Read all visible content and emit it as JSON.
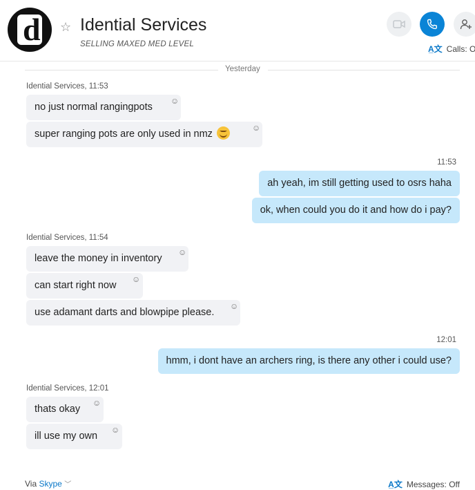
{
  "header": {
    "title": "Idential Services",
    "subtitle": "SELLING MAXED MED LEVEL",
    "calls_toggle_label": "Calls: Of"
  },
  "divider": {
    "label": "Yesterday"
  },
  "groups": [
    {
      "sender": "Idential Services, 11:53",
      "messages": [
        "no just normal rangingpots",
        "super ranging pots are only used in nmz"
      ]
    },
    {
      "time": "11:53",
      "messages": [
        "ah yeah, im still getting used to osrs haha",
        "ok, when could you do it and how do i pay?"
      ]
    },
    {
      "sender": "Idential Services, 11:54",
      "messages": [
        "leave the money in inventory",
        "can start right now",
        "use adamant darts and blowpipe please."
      ]
    },
    {
      "time": "12:01",
      "messages": [
        "hmm, i dont have an archers ring, is there any other i could use?"
      ]
    },
    {
      "sender": "Idential Services, 12:01",
      "messages": [
        "thats okay",
        "ill use my own"
      ]
    }
  ],
  "footer": {
    "via_label": "Via",
    "via_link": "Skype",
    "messages_toggle_label": "Messages: Off"
  },
  "icons": {
    "favorite": "star-outline-icon",
    "video": "video-call-icon",
    "call": "phone-icon",
    "add_people": "add-person-icon",
    "translate": "translate-icon",
    "reaction": "smiley-icon",
    "emoji": "yum-emoji-icon"
  },
  "colors": {
    "accent": "#0a84d6",
    "incoming_bubble": "#f1f2f5",
    "outgoing_bubble": "#c6e8fb"
  }
}
